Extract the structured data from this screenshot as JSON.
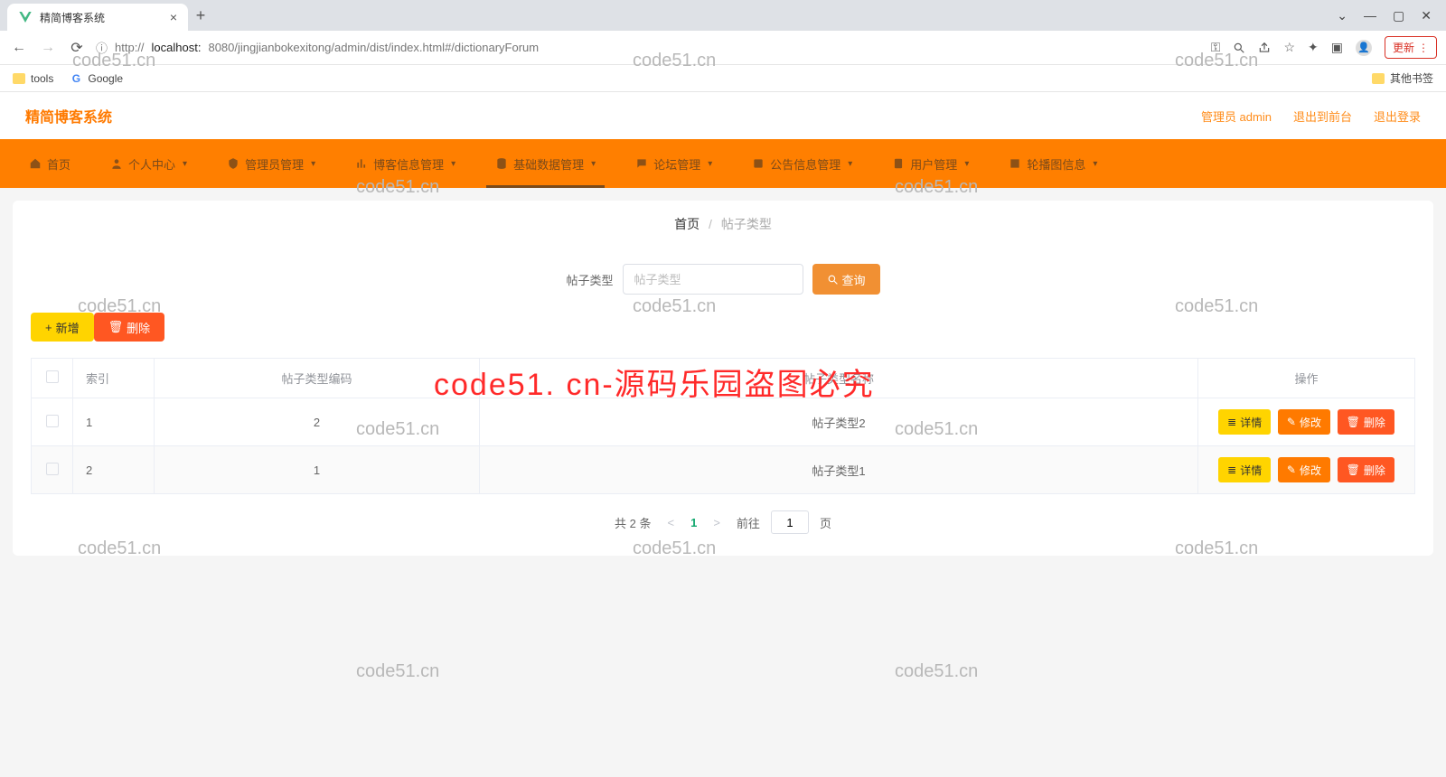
{
  "chrome": {
    "tab_title": "精简博客系统",
    "new_tab": "+",
    "win_min": "—",
    "win_max": "▢",
    "win_close": "✕",
    "win_down": "⌄",
    "url_proto": "http://",
    "url_host": "localhost:",
    "url_port_path": "8080/jingjianbokexitong/admin/dist/index.html#/dictionaryForum",
    "info_icon": "ⓘ",
    "key_icon": "⚿",
    "search_icon": "search",
    "share_icon": "share",
    "star_icon": "☆",
    "ext_icon": "✦",
    "panel_icon": "▣",
    "avatar_icon": "👤",
    "update_label": "更新",
    "update_dots": "⋮"
  },
  "bookmarks": {
    "tools": "tools",
    "google": "Google",
    "other": "其他书签"
  },
  "app": {
    "title": "精简博客系统",
    "header_links": [
      "管理员 admin",
      "退出到前台",
      "退出登录"
    ]
  },
  "nav": [
    {
      "label": "首页",
      "caret": false
    },
    {
      "label": "个人中心",
      "caret": true
    },
    {
      "label": "管理员管理",
      "caret": true
    },
    {
      "label": "博客信息管理",
      "caret": true
    },
    {
      "label": "基础数据管理",
      "caret": true,
      "active": true
    },
    {
      "label": "论坛管理",
      "caret": true
    },
    {
      "label": "公告信息管理",
      "caret": true
    },
    {
      "label": "用户管理",
      "caret": true
    },
    {
      "label": "轮播图信息",
      "caret": true
    }
  ],
  "breadcrumb": {
    "home": "首页",
    "sep": "/",
    "current": "帖子类型"
  },
  "filter": {
    "label": "帖子类型",
    "placeholder": "帖子类型",
    "search_btn": "查询"
  },
  "actions": {
    "add": "新增",
    "delete": "删除"
  },
  "table": {
    "headers": {
      "index": "索引",
      "code": "帖子类型编码",
      "name": "帖子类型名称",
      "ops": "操作"
    },
    "rows": [
      {
        "index": "1",
        "code": "2",
        "name": "帖子类型2"
      },
      {
        "index": "2",
        "code": "1",
        "name": "帖子类型1"
      }
    ],
    "ops": {
      "detail": "详情",
      "edit": "修改",
      "delete": "删除"
    }
  },
  "pager": {
    "total": "共 2 条",
    "prev": "<",
    "current": "1",
    "next": ">",
    "goto_pre": "前往",
    "goto_post": "页",
    "goto_val": "1"
  },
  "watermark": {
    "small": "code51.cn",
    "big": "code51. cn-源码乐园盗图必究"
  }
}
